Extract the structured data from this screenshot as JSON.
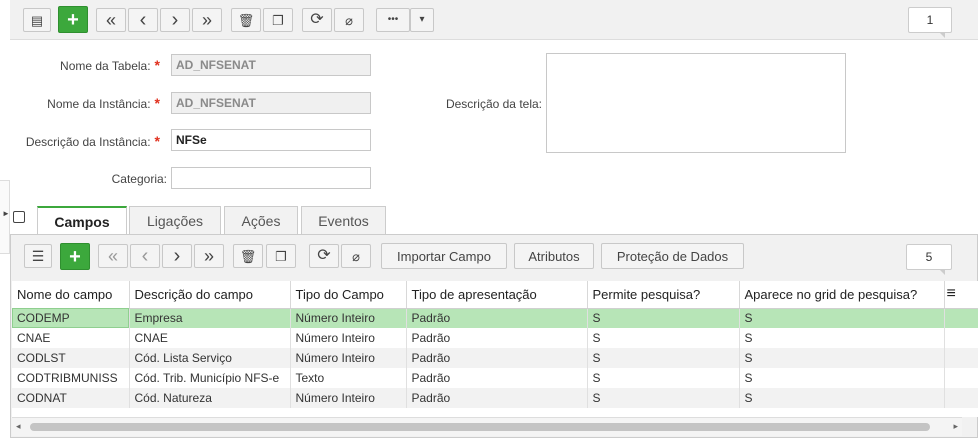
{
  "toolbar": {
    "icons": [
      "grid-view-icon",
      "add-icon",
      "first-icon",
      "previous-icon",
      "next-icon",
      "last-icon",
      "delete-icon",
      "copy-icon",
      "refresh-icon",
      "attach-icon",
      "more-icon",
      "dropdown-icon"
    ],
    "glyphs": {
      "grid": "▤",
      "add": "+",
      "first": "«",
      "prev": "‹",
      "next": "›",
      "last": "»",
      "delete": "🗑",
      "copy": "❐",
      "refresh": "⟳",
      "attach": "⌀",
      "more": "•••",
      "caret": "▾"
    },
    "record_counter": "1"
  },
  "form": {
    "table_name_label": "Nome da Tabela:",
    "table_name_value": "AD_NFSENAT",
    "instance_name_label": "Nome da Instância:",
    "instance_name_value": "AD_NFSENAT",
    "instance_desc_label": "Descrição da Instância:",
    "instance_desc_value": "NFSe",
    "category_label": "Categoria:",
    "category_value": "",
    "screen_desc_label": "Descrição da tela:",
    "screen_desc_value": "",
    "required_mark": "*"
  },
  "tabs": [
    {
      "label": "Campos",
      "active": true
    },
    {
      "label": "Ligações",
      "active": false
    },
    {
      "label": "Ações",
      "active": false
    },
    {
      "label": "Eventos",
      "active": false
    }
  ],
  "subtoolbar": {
    "import_label": "Importar Campo",
    "attributes_label": "Atributos",
    "protection_label": "Proteção de Dados",
    "record_counter": "5",
    "list_glyph": "☰",
    "menu_glyph": "≡"
  },
  "grid": {
    "columns": [
      "Nome do campo",
      "Descrição do campo",
      "Tipo do Campo",
      "Tipo de apresentação",
      "Permite pesquisa?",
      "Aparece no grid de pesquisa?"
    ],
    "rows": [
      [
        "CODEMP",
        "Empresa",
        "Número Inteiro",
        "Padrão",
        "S",
        "S"
      ],
      [
        "CNAE",
        "CNAE",
        "Número Inteiro",
        "Padrão",
        "S",
        "S"
      ],
      [
        "CODLST",
        "Cód. Lista Serviço",
        "Número Inteiro",
        "Padrão",
        "S",
        "S"
      ],
      [
        "CODTRIBMUNISS",
        "Cód. Trib. Município NFS-e",
        "Texto",
        "Padrão",
        "S",
        "S"
      ],
      [
        "CODNAT",
        "Cód. Natureza",
        "Número Inteiro",
        "Padrão",
        "S",
        "S"
      ]
    ],
    "selected_row": 0
  },
  "colors": {
    "accent_green": "#3ca83c",
    "selected_row": "#b7e5b7",
    "required": "#e0301e"
  }
}
